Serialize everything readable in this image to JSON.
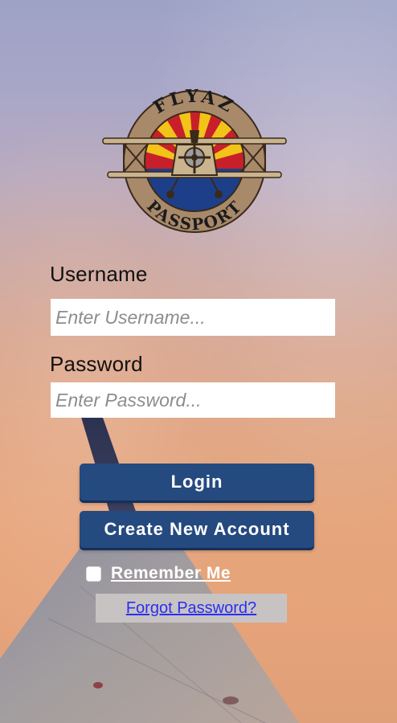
{
  "logo": {
    "top_text": "FLYAZ",
    "bottom_text": "PASSPORT"
  },
  "form": {
    "username_label": "Username",
    "username_placeholder": "Enter Username...",
    "username_value": "",
    "password_label": "Password",
    "password_placeholder": "Enter Password...",
    "password_value": ""
  },
  "buttons": {
    "login": "Login",
    "create_account": "Create New Account"
  },
  "remember_me": {
    "label": "Remember Me",
    "checked": false
  },
  "forgot_password": "Forgot Password?",
  "colors": {
    "button_bg": "#254a7f",
    "link": "#2a2ff0",
    "logo_ring": "#a8896a",
    "logo_sky_blue": "#1d3f8a",
    "logo_red": "#c8202a",
    "logo_yellow": "#f2c318"
  }
}
